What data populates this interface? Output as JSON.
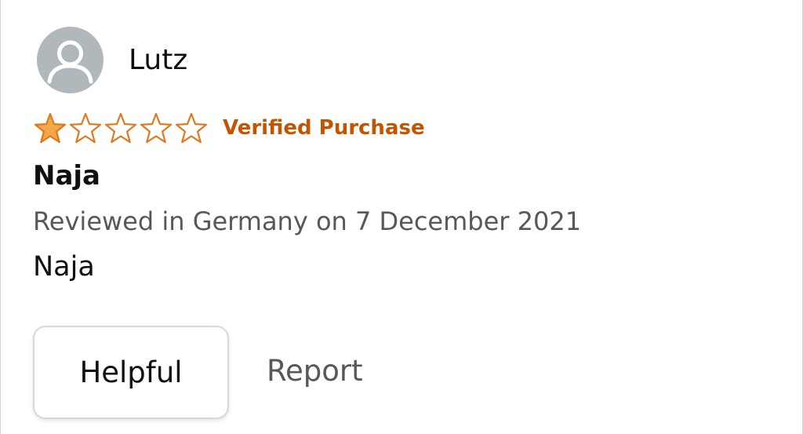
{
  "review": {
    "reviewer": {
      "name": "Lutz",
      "avatar_icon": "default-user-icon"
    },
    "rating": {
      "value": 1,
      "max": 5,
      "filled_color": "#f3a847",
      "outline_color": "#de7921"
    },
    "verified_label": "Verified Purchase",
    "title": "Naja",
    "date_line": "Reviewed in Germany on 7 December 2021",
    "body": "Naja",
    "actions": {
      "helpful_label": "Helpful",
      "report_label": "Report"
    }
  },
  "colors": {
    "verified": "#c45500",
    "text_primary": "#0f1111",
    "text_secondary": "#565959",
    "avatar_bg": "#b0b8bb"
  }
}
